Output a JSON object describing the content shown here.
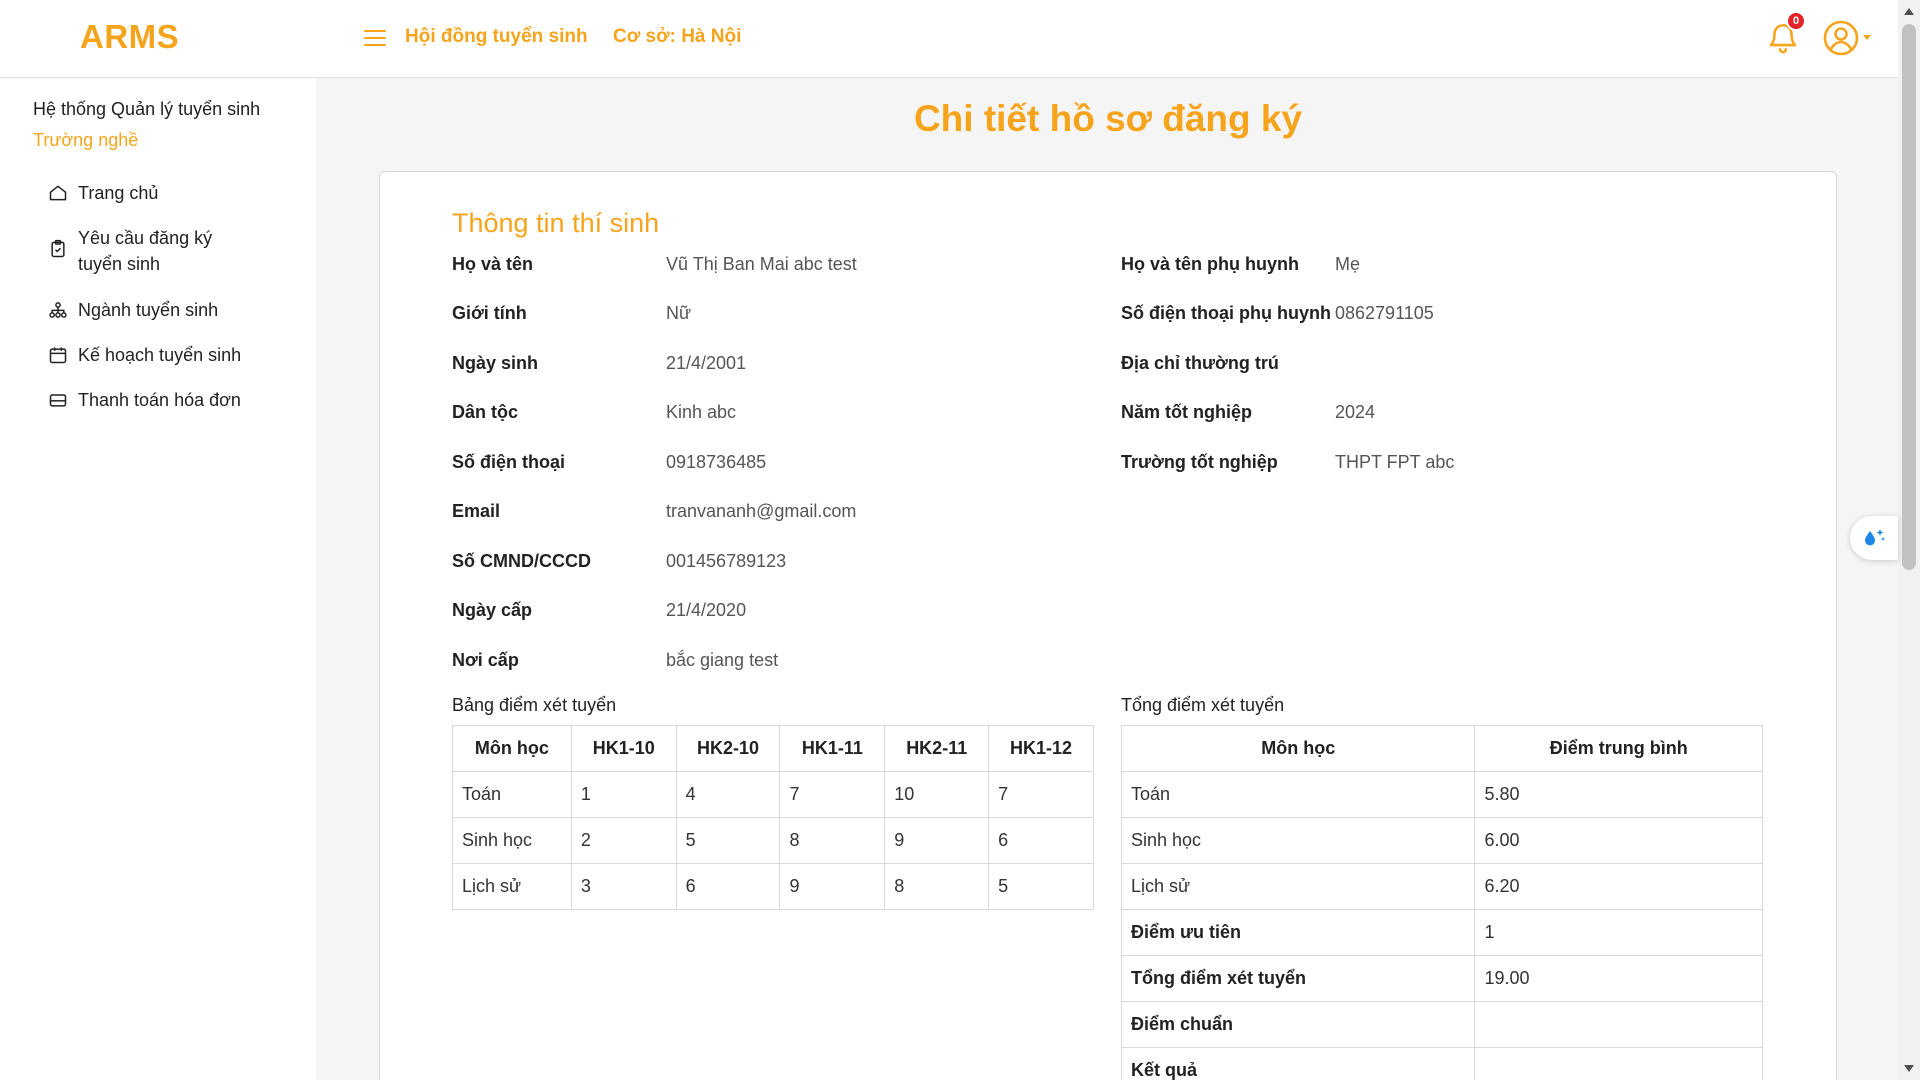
{
  "header": {
    "logo": "ARMS",
    "nav_council": "Hội đồng tuyển sinh",
    "nav_campus": "Cơ sở: Hà Nội",
    "notification_count": "0"
  },
  "sidebar": {
    "title": "Hệ thống Quản lý tuyển sinh",
    "subtitle": "Trường nghề",
    "items": [
      {
        "label": "Trang chủ",
        "icon": "home-icon"
      },
      {
        "label": "Yêu cầu đăng ký tuyển sinh",
        "icon": "clipboard-icon"
      },
      {
        "label": "Ngành tuyển sinh",
        "icon": "hierarchy-icon"
      },
      {
        "label": "Kế hoạch tuyển sinh",
        "icon": "calendar-icon"
      },
      {
        "label": "Thanh toán hóa đơn",
        "icon": "credit-card-icon"
      }
    ]
  },
  "page": {
    "title": "Chi tiết hồ sơ đăng ký",
    "section_title": "Thông tin thí sinh"
  },
  "candidate": {
    "left": [
      {
        "label": "Họ và tên",
        "value": "Vũ Thị Ban Mai abc test"
      },
      {
        "label": "Giới tính",
        "value": "Nữ"
      },
      {
        "label": "Ngày sinh",
        "value": "21/4/2001"
      },
      {
        "label": "Dân tộc",
        "value": "Kinh abc"
      },
      {
        "label": "Số điện thoại",
        "value": "0918736485"
      },
      {
        "label": "Email",
        "value": "tranvananh@gmail.com"
      },
      {
        "label": "Số CMND/CCCD",
        "value": "001456789123"
      },
      {
        "label": "Ngày cấp",
        "value": "21/4/2020"
      },
      {
        "label": "Nơi cấp",
        "value": "bắc giang test"
      }
    ],
    "right": [
      {
        "label": "Họ và tên phụ huynh",
        "value": "Mẹ"
      },
      {
        "label": "Số điện thoại phụ huynh",
        "value": "0862791105"
      },
      {
        "label": "Địa chỉ thường trú",
        "value": ""
      },
      {
        "label": "Năm tốt nghiệp",
        "value": "2024"
      },
      {
        "label": "Trường tốt nghiệp",
        "value": "THPT FPT abc"
      }
    ]
  },
  "grades_table": {
    "caption": "Bảng điểm xét tuyển",
    "headers": [
      "Môn học",
      "HK1-10",
      "HK2-10",
      "HK1-11",
      "HK2-11",
      "HK1-12"
    ],
    "rows": [
      [
        "Toán",
        "1",
        "4",
        "7",
        "10",
        "7"
      ],
      [
        "Sinh học",
        "2",
        "5",
        "8",
        "9",
        "6"
      ],
      [
        "Lịch sử",
        "3",
        "6",
        "9",
        "8",
        "5"
      ]
    ]
  },
  "summary_table": {
    "caption": "Tổng điểm xét tuyển",
    "headers": [
      "Môn học",
      "Điểm trung bình"
    ],
    "rows": [
      [
        "Toán",
        "5.80"
      ],
      [
        "Sinh học",
        "6.00"
      ],
      [
        "Lịch sử",
        "6.20"
      ],
      [
        "Điểm ưu tiên",
        "1"
      ],
      [
        "Tổng điểm xét tuyển",
        "19.00"
      ],
      [
        "Điểm chuẩn",
        ""
      ],
      [
        "Kết quả",
        ""
      ]
    ]
  },
  "colors": {
    "accent": "#f7a41d",
    "badge": "#e0242a"
  }
}
